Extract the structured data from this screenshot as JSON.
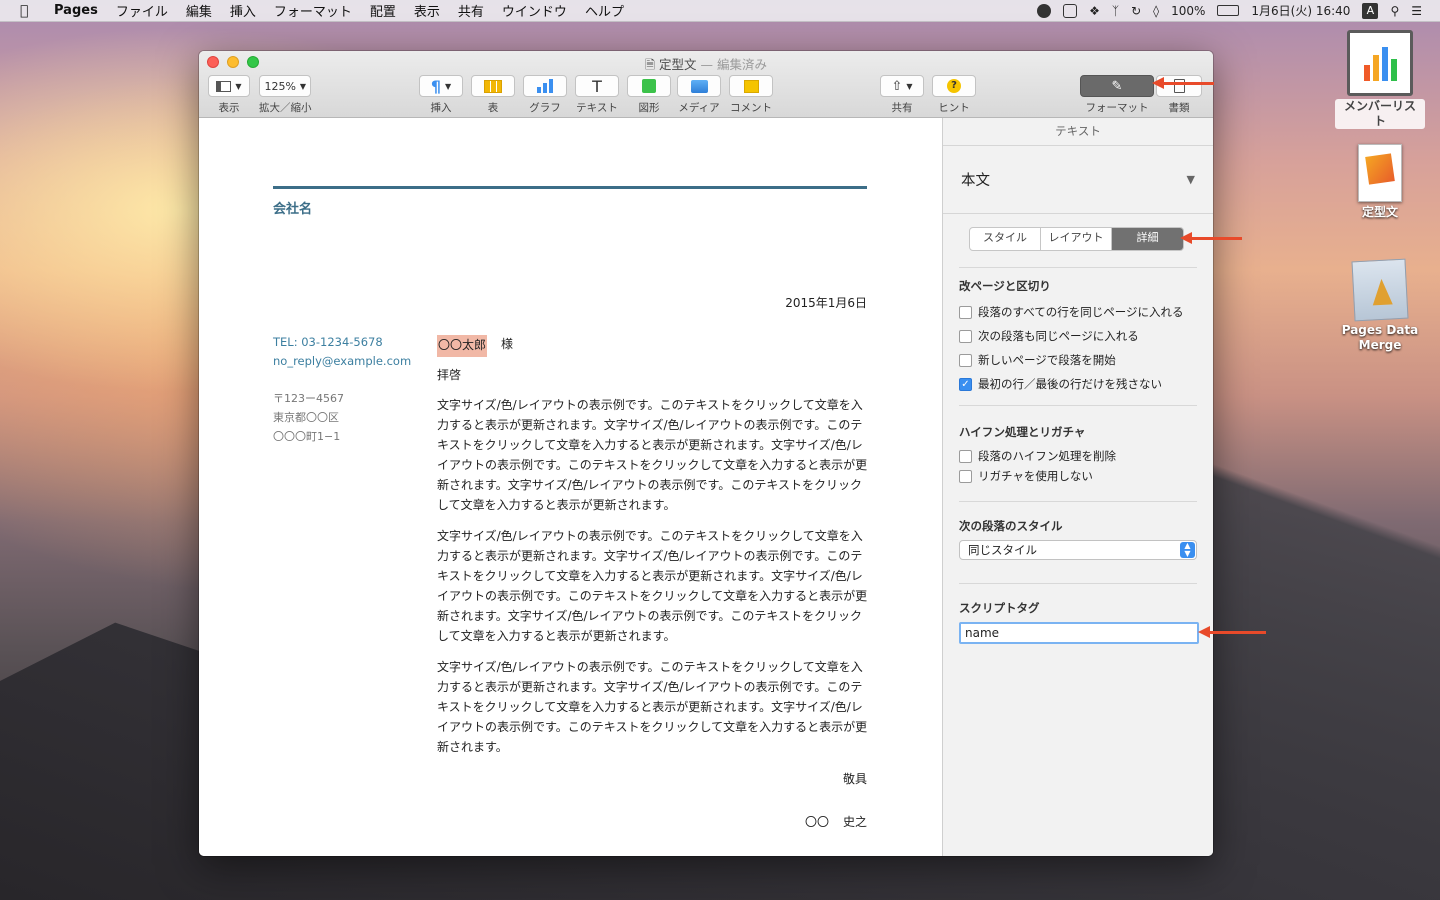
{
  "menubar": {
    "app": "Pages",
    "items": [
      "ファイル",
      "編集",
      "挿入",
      "フォーマット",
      "配置",
      "表示",
      "共有",
      "ウインドウ",
      "ヘルプ"
    ],
    "battery": "100%",
    "datetime": "1月6日(火) 16:40",
    "input_badge": "A"
  },
  "window": {
    "title": "定型文",
    "title_sep": " — ",
    "edited": "編集済み"
  },
  "toolbar": {
    "view_label": "表示",
    "zoom_value": "125%",
    "zoom_label": "拡大／縮小",
    "insert_label": "挿入",
    "table_label": "表",
    "chart_label": "グラフ",
    "text_label": "テキスト",
    "shape_label": "図形",
    "media_label": "メディア",
    "comment_label": "コメント",
    "share_label": "共有",
    "tips_label": "ヒント",
    "format_label": "フォーマット",
    "document_label": "書類"
  },
  "document": {
    "company": "会社名",
    "date": "2015年1月6日",
    "tel": "TEL: 03-1234-5678",
    "email": "no_reply@example.com",
    "address": [
      "〒123ー4567",
      "東京都〇〇区",
      "〇〇〇町1−1"
    ],
    "recipient_name": "〇〇太郎",
    "recipient_suffix": "様",
    "greeting": "拝啓",
    "paragraphs": [
      "文字サイズ/色/レイアウトの表示例です。このテキストをクリックして文章を入力すると表示が更新されます。文字サイズ/色/レイアウトの表示例です。このテキストをクリックして文章を入力すると表示が更新されます。文字サイズ/色/レイアウトの表示例です。このテキストをクリックして文章を入力すると表示が更新されます。文字サイズ/色/レイアウトの表示例です。このテキストをクリックして文章を入力すると表示が更新されます。",
      "文字サイズ/色/レイアウトの表示例です。このテキストをクリックして文章を入力すると表示が更新されます。文字サイズ/色/レイアウトの表示例です。このテキストをクリックして文章を入力すると表示が更新されます。文字サイズ/色/レイアウトの表示例です。このテキストをクリックして文章を入力すると表示が更新されます。文字サイズ/色/レイアウトの表示例です。このテキストをクリックして文章を入力すると表示が更新されます。",
      "文字サイズ/色/レイアウトの表示例です。このテキストをクリックして文章を入力すると表示が更新されます。文字サイズ/色/レイアウトの表示例です。このテキストをクリックして文章を入力すると表示が更新されます。文字サイズ/色/レイアウトの表示例です。このテキストをクリックして文章を入力すると表示が更新されます。"
    ],
    "closing": "敬具",
    "sign_prefix": "〇〇",
    "sign_name": "史之"
  },
  "inspector": {
    "header": "テキスト",
    "paragraph_style": "本文",
    "tabs": [
      "スタイル",
      "レイアウト",
      "詳細"
    ],
    "active_tab": "詳細",
    "pagination": {
      "title": "改ページと区切り",
      "options": [
        {
          "label": "段落のすべての行を同じページに入れる",
          "checked": false
        },
        {
          "label": "次の段落も同じページに入れる",
          "checked": false
        },
        {
          "label": "新しいページで段落を開始",
          "checked": false
        },
        {
          "label": "最初の行／最後の行だけを残さない",
          "checked": true
        }
      ]
    },
    "hyphenation": {
      "title": "ハイフン処理とリガチャ",
      "options": [
        {
          "label": "段落のハイフン処理を削除",
          "checked": false
        },
        {
          "label": "リガチャを使用しない",
          "checked": false
        }
      ]
    },
    "next_style": {
      "title": "次の段落のスタイル",
      "value": "同じスタイル"
    },
    "script_tag": {
      "title": "スクリプトタグ",
      "value": "name"
    }
  },
  "desktop": {
    "icons": [
      {
        "label": "メンバーリスト"
      },
      {
        "label": "定型文"
      },
      {
        "label": "Pages Data Merge"
      }
    ]
  },
  "colors": {
    "accent_blue": "#3a8ff0",
    "heading_teal": "#3c6e88",
    "annotation_arrow": "#e84a2a",
    "name_highlight": "#f1b8a6"
  }
}
